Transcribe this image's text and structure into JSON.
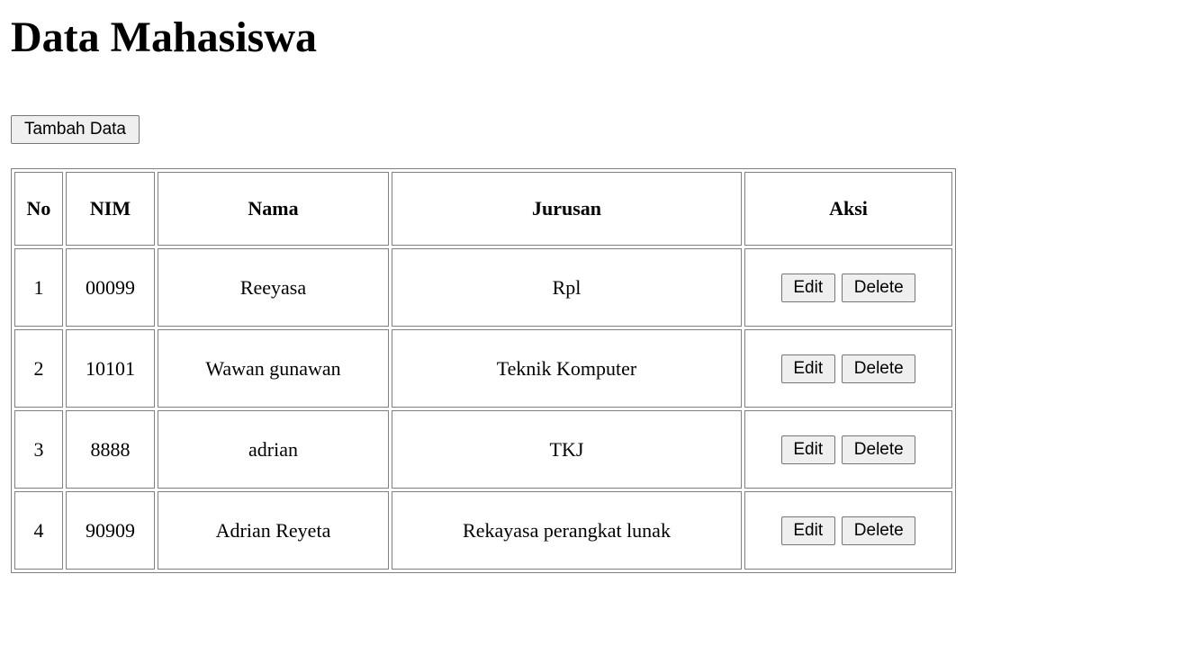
{
  "page": {
    "title": "Data Mahasiswa",
    "add_button_label": "Tambah Data"
  },
  "table": {
    "headers": {
      "no": "No",
      "nim": "NIM",
      "nama": "Nama",
      "jurusan": "Jurusan",
      "aksi": "Aksi"
    },
    "rows": [
      {
        "no": "1",
        "nim": "00099",
        "nama": "Reeyasa",
        "jurusan": "Rpl",
        "edit_label": "Edit",
        "delete_label": "Delete"
      },
      {
        "no": "2",
        "nim": "10101",
        "nama": "Wawan gunawan",
        "jurusan": "Teknik Komputer",
        "edit_label": "Edit",
        "delete_label": "Delete"
      },
      {
        "no": "3",
        "nim": "8888",
        "nama": "adrian",
        "jurusan": "TKJ",
        "edit_label": "Edit",
        "delete_label": "Delete"
      },
      {
        "no": "4",
        "nim": "90909",
        "nama": "Adrian Reyeta",
        "jurusan": "Rekayasa perangkat lunak",
        "edit_label": "Edit",
        "delete_label": "Delete"
      }
    ]
  }
}
